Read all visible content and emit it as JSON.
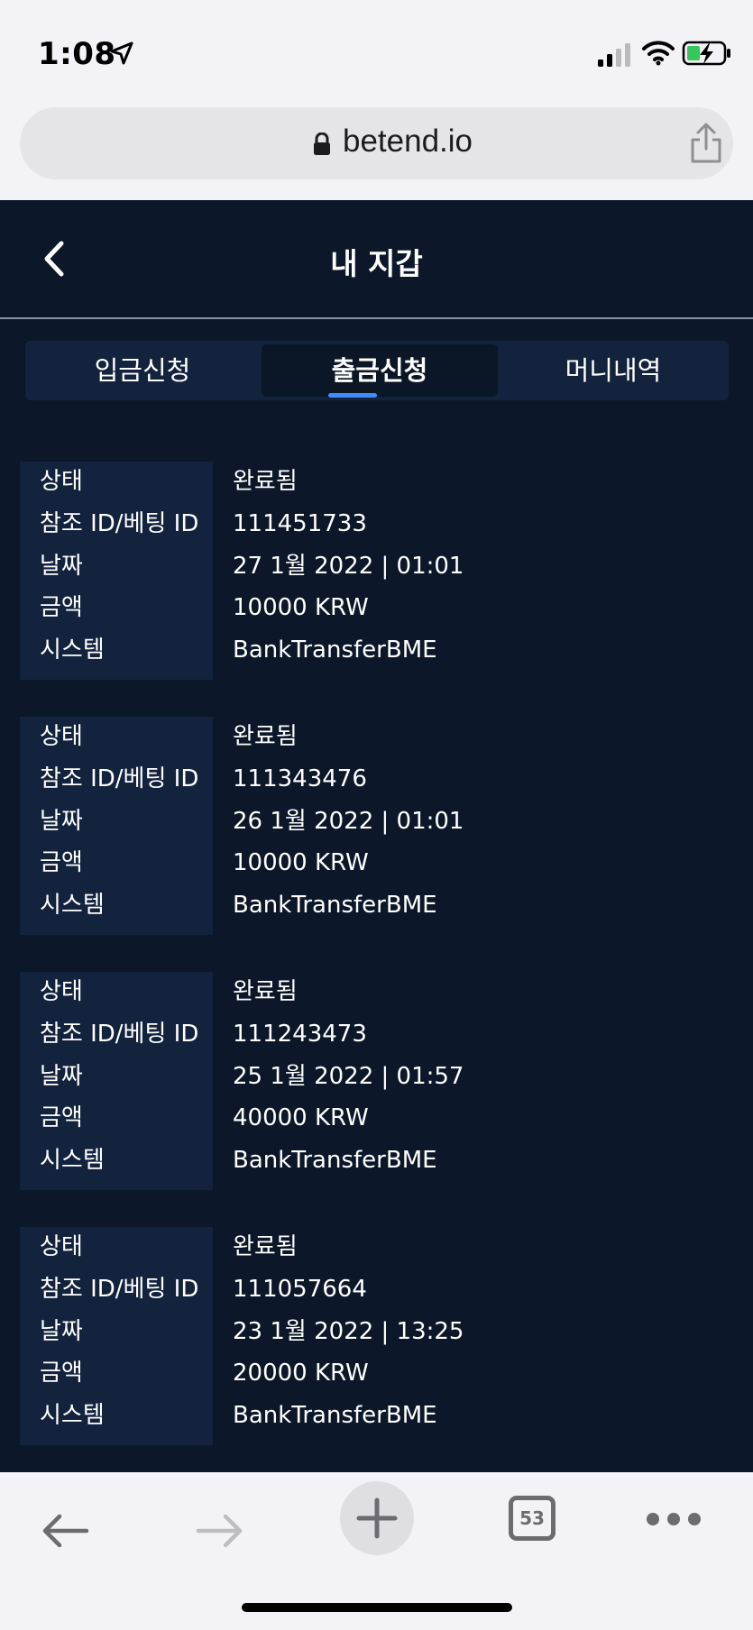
{
  "status_bar": {
    "time": "1:08"
  },
  "browser": {
    "url": "betend.io",
    "open_tabs": "53"
  },
  "header": {
    "title": "내 지갑"
  },
  "tabs": [
    {
      "label": "입금신청",
      "active": false
    },
    {
      "label": "출금신청",
      "active": true
    },
    {
      "label": "머니내역",
      "active": false
    }
  ],
  "labels": {
    "status": "상태",
    "ref_id": "참조 ID/베팅 ID",
    "date": "날짜",
    "amount": "금액",
    "system": "시스템"
  },
  "records": [
    {
      "status": "완료됨",
      "ref_id": "111451733",
      "date": "27 1월 2022 | 01:01",
      "amount": "10000 KRW",
      "system": "BankTransferBME"
    },
    {
      "status": "완료됨",
      "ref_id": "111343476",
      "date": "26 1월 2022 | 01:01",
      "amount": "10000 KRW",
      "system": "BankTransferBME"
    },
    {
      "status": "완료됨",
      "ref_id": "111243473",
      "date": "25 1월 2022 | 01:57",
      "amount": "40000 KRW",
      "system": "BankTransferBME"
    },
    {
      "status": "완료됨",
      "ref_id": "111057664",
      "date": "23 1월 2022 | 13:25",
      "amount": "20000 KRW",
      "system": "BankTransferBME"
    }
  ],
  "colors": {
    "background": "#0c1729",
    "panel": "#13233d",
    "accent": "#3f8cff"
  }
}
